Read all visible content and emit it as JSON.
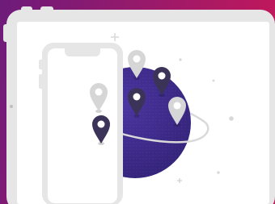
{
  "illustration": {
    "colors": {
      "background_start": "#6d1b7b",
      "background_end": "#c2185b",
      "device_frame": "#e6e6e6",
      "device_screen": "#ffffff",
      "globe": "#3f2a8c",
      "orbit": "#d9d9d9",
      "pin_light": "#d6d6d6",
      "pin_dark": "#3b3458",
      "pin_center": "#ffffff",
      "sparkle": "#d8d8d8"
    },
    "devices": [
      "tablet",
      "phone"
    ],
    "pins": [
      {
        "style": "light"
      },
      {
        "style": "dark"
      },
      {
        "style": "light"
      },
      {
        "style": "dark"
      },
      {
        "style": "dark"
      },
      {
        "style": "light"
      }
    ]
  }
}
